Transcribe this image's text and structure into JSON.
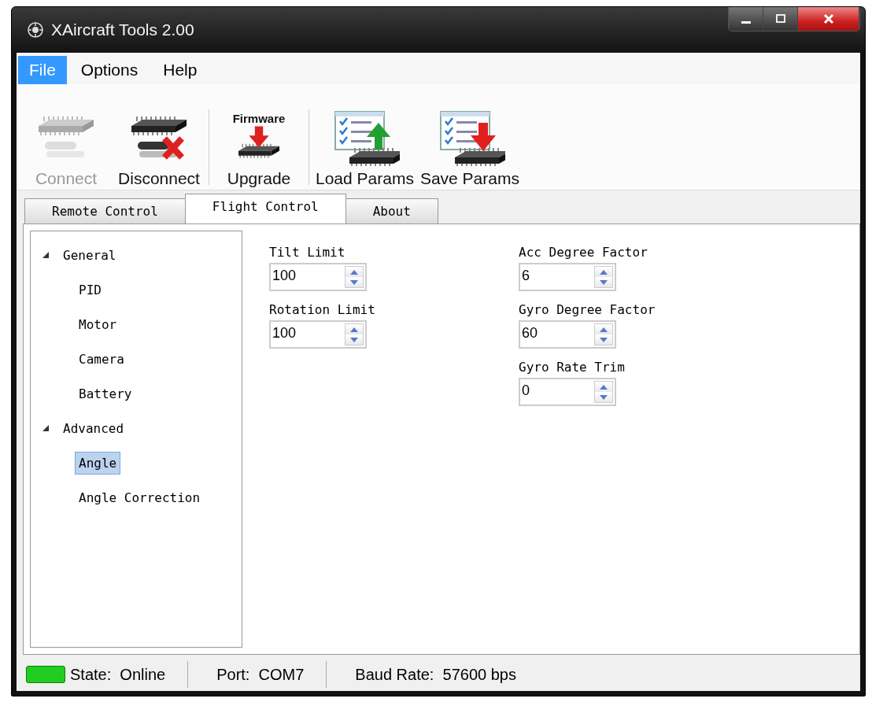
{
  "window": {
    "title": "XAircraft Tools 2.00"
  },
  "menu": [
    {
      "label": "File",
      "selected": true
    },
    {
      "label": "Options",
      "selected": false
    },
    {
      "label": "Help",
      "selected": false
    }
  ],
  "toolbar": [
    [
      {
        "label": "Connect",
        "kind": "connect",
        "disabled": true
      },
      {
        "label": "Disconnect",
        "kind": "disconnect",
        "disabled": false
      }
    ],
    [
      {
        "label": "Upgrade",
        "kind": "upgrade",
        "caption": "Firmware",
        "disabled": false
      }
    ],
    [
      {
        "label": "Load Params",
        "kind": "load",
        "disabled": false
      },
      {
        "label": "Save Params",
        "kind": "save",
        "disabled": false
      }
    ]
  ],
  "tabs": [
    {
      "label": "Remote Control",
      "selected": false
    },
    {
      "label": "Flight Control",
      "selected": true
    },
    {
      "label": "About",
      "selected": false
    }
  ],
  "tree": [
    {
      "label": "General",
      "expanded": true,
      "selected": false,
      "children": [
        {
          "label": "PID",
          "selected": false
        },
        {
          "label": "Motor",
          "selected": false
        },
        {
          "label": "Camera",
          "selected": false
        },
        {
          "label": "Battery",
          "selected": false
        }
      ]
    },
    {
      "label": "Advanced",
      "expanded": true,
      "selected": false,
      "children": [
        {
          "label": "Angle",
          "selected": true
        },
        {
          "label": "Angle Correction",
          "selected": false
        }
      ]
    }
  ],
  "params": [
    [
      {
        "label": "Tilt Limit",
        "value": "100"
      },
      {
        "label": "Rotation Limit",
        "value": "100"
      }
    ],
    [
      {
        "label": "Acc Degree Factor",
        "value": "6"
      },
      {
        "label": "Gyro Degree Factor",
        "value": "60"
      },
      {
        "label": "Gyro Rate Trim",
        "value": "0"
      }
    ]
  ],
  "status_bar": [
    {
      "text": "State:  Online",
      "color": "#22cc22"
    },
    {
      "text": "Port:  COM7"
    },
    {
      "text": "Baud Rate:  57600 bps"
    }
  ]
}
